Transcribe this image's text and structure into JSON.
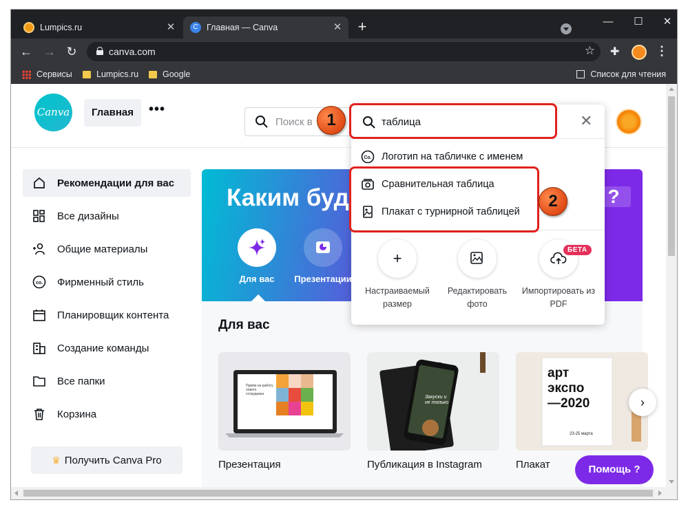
{
  "browser": {
    "tabs": [
      {
        "title": "Lumpics.ru",
        "active": false
      },
      {
        "title": "Главная — Canva",
        "active": true
      }
    ],
    "tab_favicon_letter": "C",
    "url": "canva.com",
    "bookmarks": [
      "Сервисы",
      "Lumpics.ru",
      "Google"
    ],
    "reading_list": "Список для чтения"
  },
  "header": {
    "logo_text": "Canva",
    "home_label": "Главная",
    "more_label": "•••",
    "search_placeholder": "Поиск в"
  },
  "sidebar": {
    "items": [
      {
        "label": "Рекомендации для вас",
        "icon": "home-icon",
        "active": true
      },
      {
        "label": "Все дизайны",
        "icon": "grid-icon"
      },
      {
        "label": "Общие материалы",
        "icon": "people-icon"
      },
      {
        "label": "Фирменный стиль",
        "icon": "brand-icon"
      },
      {
        "label": "Планировщик контента",
        "icon": "calendar-icon"
      },
      {
        "label": "Создание команды",
        "icon": "team-icon"
      },
      {
        "label": "Все папки",
        "icon": "folder-icon"
      },
      {
        "label": "Корзина",
        "icon": "trash-icon"
      }
    ],
    "pro_button": "Получить Canva Pro"
  },
  "hero": {
    "title": "Каким буде",
    "title_end": "?",
    "categories": [
      {
        "label": "Для вас",
        "icon": "sparkle-icon"
      },
      {
        "label": "Презентации",
        "icon": "presentation-icon"
      }
    ]
  },
  "section_title": "Для вас",
  "cards": [
    {
      "label": "Презентация",
      "thumb_text": "Приём на работу нового сотрудника"
    },
    {
      "label": "Публикация в Instagram",
      "thumb_text": "Закуски и не только"
    },
    {
      "label": "Плакат",
      "thumb_text": "арт экспо —2020",
      "thumb_small": "23-25 марта"
    }
  ],
  "help_button": "Помощь ?",
  "search_dropdown": {
    "query": "таблица",
    "suggestions": [
      {
        "label": "Логотип на табличке с именем",
        "icon": "brand-icon"
      },
      {
        "label": "Сравнительная таблица",
        "icon": "template-icon"
      },
      {
        "label": "Плакат с турнирной таблицей",
        "icon": "image-icon"
      }
    ],
    "quick_actions": [
      {
        "label": "Настраиваемый размер",
        "icon": "plus-icon"
      },
      {
        "label": "Редактировать фото",
        "icon": "photo-edit-icon"
      },
      {
        "label": "Импортировать из PDF",
        "icon": "upload-icon"
      }
    ],
    "beta_badge": "БЕТА"
  },
  "annotations": {
    "step1": "1",
    "step2": "2",
    "color": "#e0211c"
  },
  "colors": {
    "canva_teal": "#00c4cc",
    "canva_purple": "#7d2ae8",
    "beta_red": "#e4305a"
  }
}
